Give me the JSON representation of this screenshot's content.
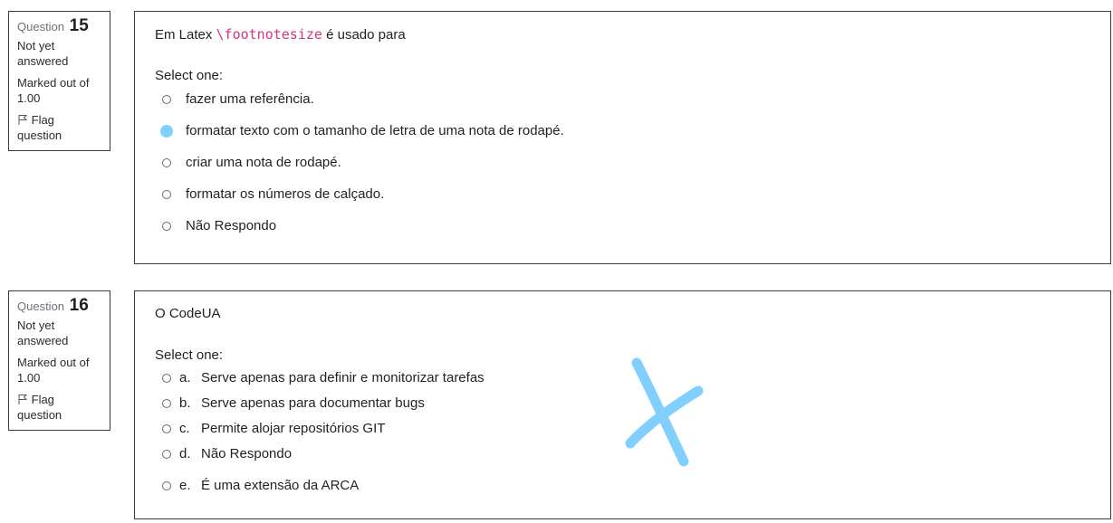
{
  "questions": [
    {
      "label": "Question",
      "number": "15",
      "state": "Not yet answered",
      "grade": "Marked out of 1.00",
      "flag": "Flag question",
      "text_before": "Em Latex ",
      "text_code": "\\footnotesize",
      "text_after": " é usado para",
      "prompt": "Select one:",
      "options": [
        {
          "label": "fazer uma referência.",
          "selected": false
        },
        {
          "label": "formatar texto com o tamanho de letra de uma nota de rodapé.",
          "selected": true
        },
        {
          "label": "criar uma nota de rodapé.",
          "selected": false
        },
        {
          "label": "formatar os números de calçado.",
          "selected": false
        },
        {
          "label": "Não Respondo",
          "selected": false
        }
      ]
    },
    {
      "label": "Question",
      "number": "16",
      "state": "Not yet answered",
      "grade": "Marked out of 1.00",
      "flag": "Flag question",
      "text": "O CodeUA",
      "prompt": "Select one:",
      "options": [
        {
          "letter": "a.",
          "label": "Serve apenas para definir e monitorizar tarefas",
          "selected": false
        },
        {
          "letter": "b.",
          "label": "Serve apenas para documentar bugs",
          "selected": false
        },
        {
          "letter": "c.",
          "label": "Permite alojar repositórios GIT",
          "selected": false
        },
        {
          "letter": "d.",
          "label": "Não Respondo",
          "selected": false
        },
        {
          "letter": "e.",
          "label": "É uma extensão da ARCA",
          "selected": false
        }
      ]
    }
  ],
  "colors": {
    "selected_radio": "#81cfff",
    "annotation_mark": "#81cfff",
    "code_text": "#d63384",
    "border": "#3a3a3a"
  },
  "annotation": {
    "icon": "handwritten-x-mark"
  }
}
